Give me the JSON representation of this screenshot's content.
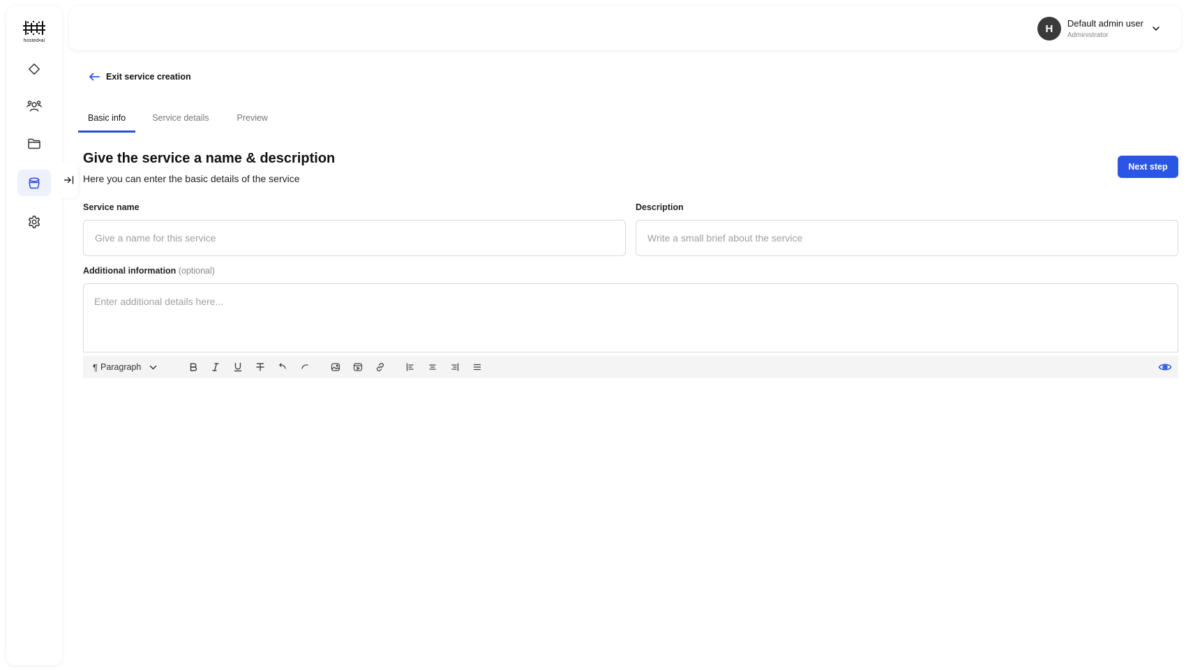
{
  "app": {
    "logo_text": "hosted•ai"
  },
  "sidebar": {
    "items": [
      {
        "icon": "diamond-icon",
        "active": false
      },
      {
        "icon": "users-icon",
        "active": false
      },
      {
        "icon": "folder-icon",
        "active": false
      },
      {
        "icon": "services-icon",
        "active": true
      },
      {
        "icon": "gear-icon",
        "active": false
      }
    ]
  },
  "user": {
    "avatar_initial": "H",
    "name": "Default admin user",
    "role": "Administrator"
  },
  "header": {
    "exit_label": "Exit service creation"
  },
  "tabs": [
    {
      "label": "Basic info",
      "active": true
    },
    {
      "label": "Service details",
      "active": false
    },
    {
      "label": "Preview",
      "active": false
    }
  ],
  "main": {
    "title": "Give the service a name & description",
    "subtitle": "Here you can enter the basic details of the service",
    "next_label": "Next step"
  },
  "form": {
    "service_name": {
      "label": "Service name",
      "value": "",
      "placeholder": "Give a name for this service"
    },
    "description": {
      "label": "Description",
      "value": "",
      "placeholder": "Write a small brief about the service"
    },
    "additional": {
      "label": "Additional information",
      "optional_label": "(optional)",
      "value": "",
      "placeholder": "Enter additional details here..."
    }
  },
  "editor": {
    "paragraph_label": "Paragraph",
    "tools": [
      "bold-icon",
      "italic-icon",
      "underline-icon",
      "strikethrough-icon",
      "undo-icon",
      "redo-icon",
      "image-icon",
      "video-icon",
      "link-icon",
      "align-left-icon",
      "align-center-icon",
      "align-right-icon",
      "align-justify-icon"
    ],
    "preview_icon": "eye-icon"
  },
  "colors": {
    "accent": "#2b55e6",
    "active_nav_bg": "#eef1fb",
    "avatar_bg": "#3a3a3a"
  }
}
